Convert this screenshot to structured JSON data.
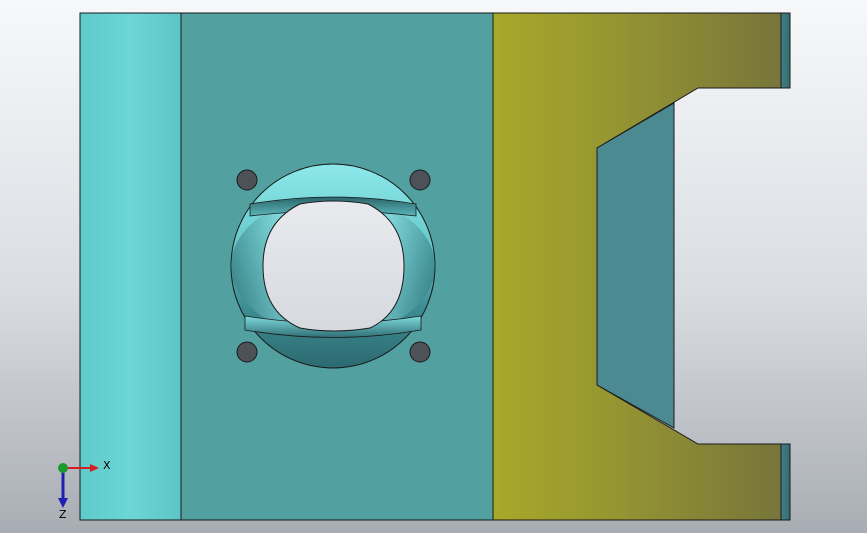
{
  "viewport": {
    "background_top": "#f7f8fa",
    "background_bottom": "#a8acb3"
  },
  "colors": {
    "cyan_face_light": "#6fd4d4",
    "cyan_face_main": "#52a0a0",
    "dark_teal": "#3f7f86",
    "olive_face_left": "#a6a62b",
    "olive_face_right": "#7a7a38",
    "edge": "#1a1a1a"
  },
  "triad": {
    "x_label": "X",
    "z_label": "Z",
    "x_color": "#d42020",
    "y_color": "#1a9a2a",
    "z_color": "#2020b0"
  },
  "features": [
    "through-hole",
    "mounting-hole",
    "mounting-hole",
    "mounting-hole",
    "mounting-hole",
    "slot-cutout"
  ]
}
